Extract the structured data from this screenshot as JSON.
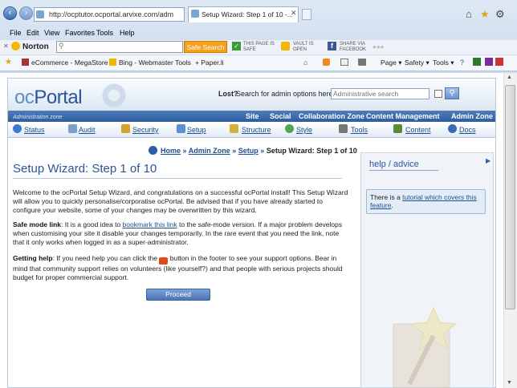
{
  "browser": {
    "address": "http://ocptutor.ocportal.arvixe.com/adm",
    "tab_title": "Setup Wizard: Step 1 of 10 -...",
    "menu": [
      "File",
      "Edit",
      "View",
      "Favorites",
      "Tools",
      "Help"
    ],
    "norton": {
      "brand": "Norton",
      "search_button": "Safe Search",
      "page_is_safe_1": "THIS PAGE IS",
      "page_is_safe_2": "SAFE",
      "vault_1": "VAULT IS",
      "vault_2": "OPEN",
      "share_1": "SHARE VIA",
      "share_2": "FACEBOOK"
    },
    "favorites": [
      {
        "label": "eCommerce - MegaStore ..."
      },
      {
        "label": "Bing - Webmaster Tools"
      },
      {
        "label": "Paper.li"
      }
    ],
    "command_bar": {
      "page": "Page",
      "safety": "Safety",
      "tools": "Tools"
    }
  },
  "site": {
    "logo_oc": "oc",
    "logo_portal": "Portal",
    "lost_label": "Lost?",
    "search_label": "Search for admin options here →",
    "search_placeholder": "Administrative search",
    "zone_caption": "Administration zone",
    "zones": [
      "Site",
      "Social",
      "Collaboration Zone",
      "Content Management",
      "Admin Zone"
    ],
    "tabs": [
      "Status",
      "Audit",
      "Security",
      "Setup",
      "Structure",
      "Style",
      "Tools",
      "Content",
      "Docs"
    ],
    "breadcrumb": {
      "home": "Home",
      "sep": "»",
      "admin_zone": "Admin Zone",
      "setup": "Setup",
      "current": "Setup Wizard: Step 1 of 10"
    },
    "title": "Setup Wizard: Step 1 of 10",
    "intro": "Welcome to the ocPortal Setup Wizard, and congratulations on a successful ocPortal install! This Setup Wizard will allow you to quickly personalise/corporatise ocPortal. Be advised that if you have already started to configure your website, some of your changes may be overwritten by this wizard.",
    "safe_mode": {
      "label": "Safe mode link",
      "pre": ": It is a good idea to ",
      "link": "bookmark this link",
      "post": " to the safe-mode version. If a major problem develops when customising your site it disable your changes temporarily. In the rare event that you need the link, note that it only works when logged in as a super-administrator."
    },
    "help": {
      "label": "Getting help",
      "pre": ": If you need help you can click the ",
      "post": " button in the footer to see your support options. Bear in mind that community support relies on volunteers (like yourself?) and that people with serious projects should budget for proper commercial support."
    },
    "proceed": "Proceed",
    "panel": {
      "heading": "help / advice",
      "pre": "There is a ",
      "link": "tutorial which covers this feature",
      "post": "."
    }
  }
}
